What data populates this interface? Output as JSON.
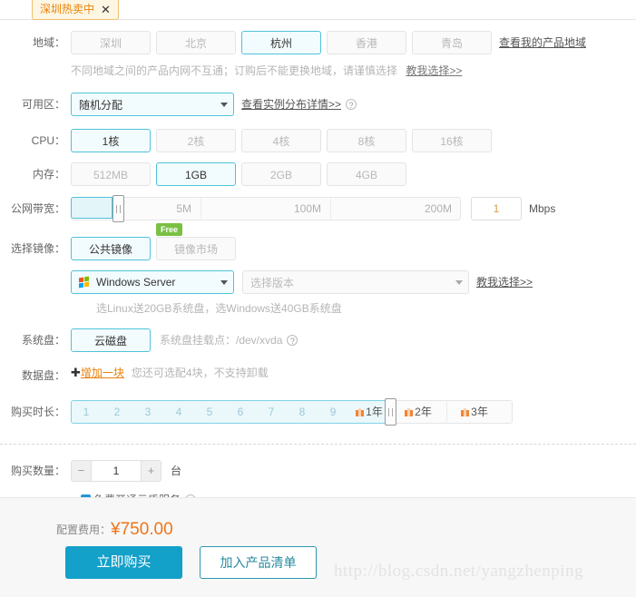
{
  "tooltip": {
    "text": "深圳热卖中",
    "close": "✕"
  },
  "region": {
    "label": "地域：",
    "options": [
      "深圳",
      "北京",
      "杭州",
      "香港",
      "青岛"
    ],
    "selected": "杭州",
    "link": "查看我的产品地域",
    "hint": "不同地域之间的产品内网不互通；订购后不能更换地域，请谨慎选择",
    "hint_link": "教我选择>>"
  },
  "zone": {
    "label": "可用区：",
    "value": "随机分配",
    "link": "查看实例分布详情>>"
  },
  "cpu": {
    "label": "CPU：",
    "options": [
      "1核",
      "2核",
      "4核",
      "8核",
      "16核"
    ],
    "selected": "1核"
  },
  "memory": {
    "label": "内存：",
    "options": [
      "512MB",
      "1GB",
      "2GB",
      "4GB"
    ],
    "selected": "1GB"
  },
  "bandwidth": {
    "label": "公网带宽：",
    "ticks": [
      "5M",
      "100M",
      "200M"
    ],
    "value": "1",
    "unit": "Mbps"
  },
  "image": {
    "label": "选择镜像：",
    "options": [
      "公共镜像",
      "镜像市场"
    ],
    "selected": "公共镜像",
    "badge": "Free",
    "os_value": "Windows Server",
    "version_placeholder": "选择版本",
    "link": "教我选择>>",
    "hint": "选Linux送20GB系统盘，选Windows送40GB系统盘"
  },
  "system_disk": {
    "label": "系统盘：",
    "option": "云磁盘",
    "mount_text": "系统盘挂载点：/dev/xvda"
  },
  "data_disk": {
    "label": "数据盘：",
    "add_label": "增加一块",
    "hint": "您还可选配4块，不支持卸载"
  },
  "duration": {
    "label": "购买时长：",
    "months": [
      "1",
      "2",
      "3",
      "4",
      "5",
      "6",
      "7",
      "8",
      "9"
    ],
    "years": [
      "1年",
      "2年",
      "3年"
    ],
    "selected": "1年"
  },
  "quantity": {
    "label": "购买数量：",
    "minus": "−",
    "value": "1",
    "plus": "+",
    "unit": "台",
    "service_link": "免费开通云盾服务"
  },
  "footer": {
    "price_label": "配置费用：",
    "price_value": "¥750.00",
    "buy_button": "立即购买",
    "add_button": "加入产品清单"
  },
  "watermark": "http://blog.csdn.net/yangzhenping",
  "colors": {
    "accent": "#4fc3d9",
    "price": "#ef7518",
    "buy_button": "#13a0c9",
    "badge_green": "#7ac143",
    "tooltip_orange": "#e8820c"
  }
}
